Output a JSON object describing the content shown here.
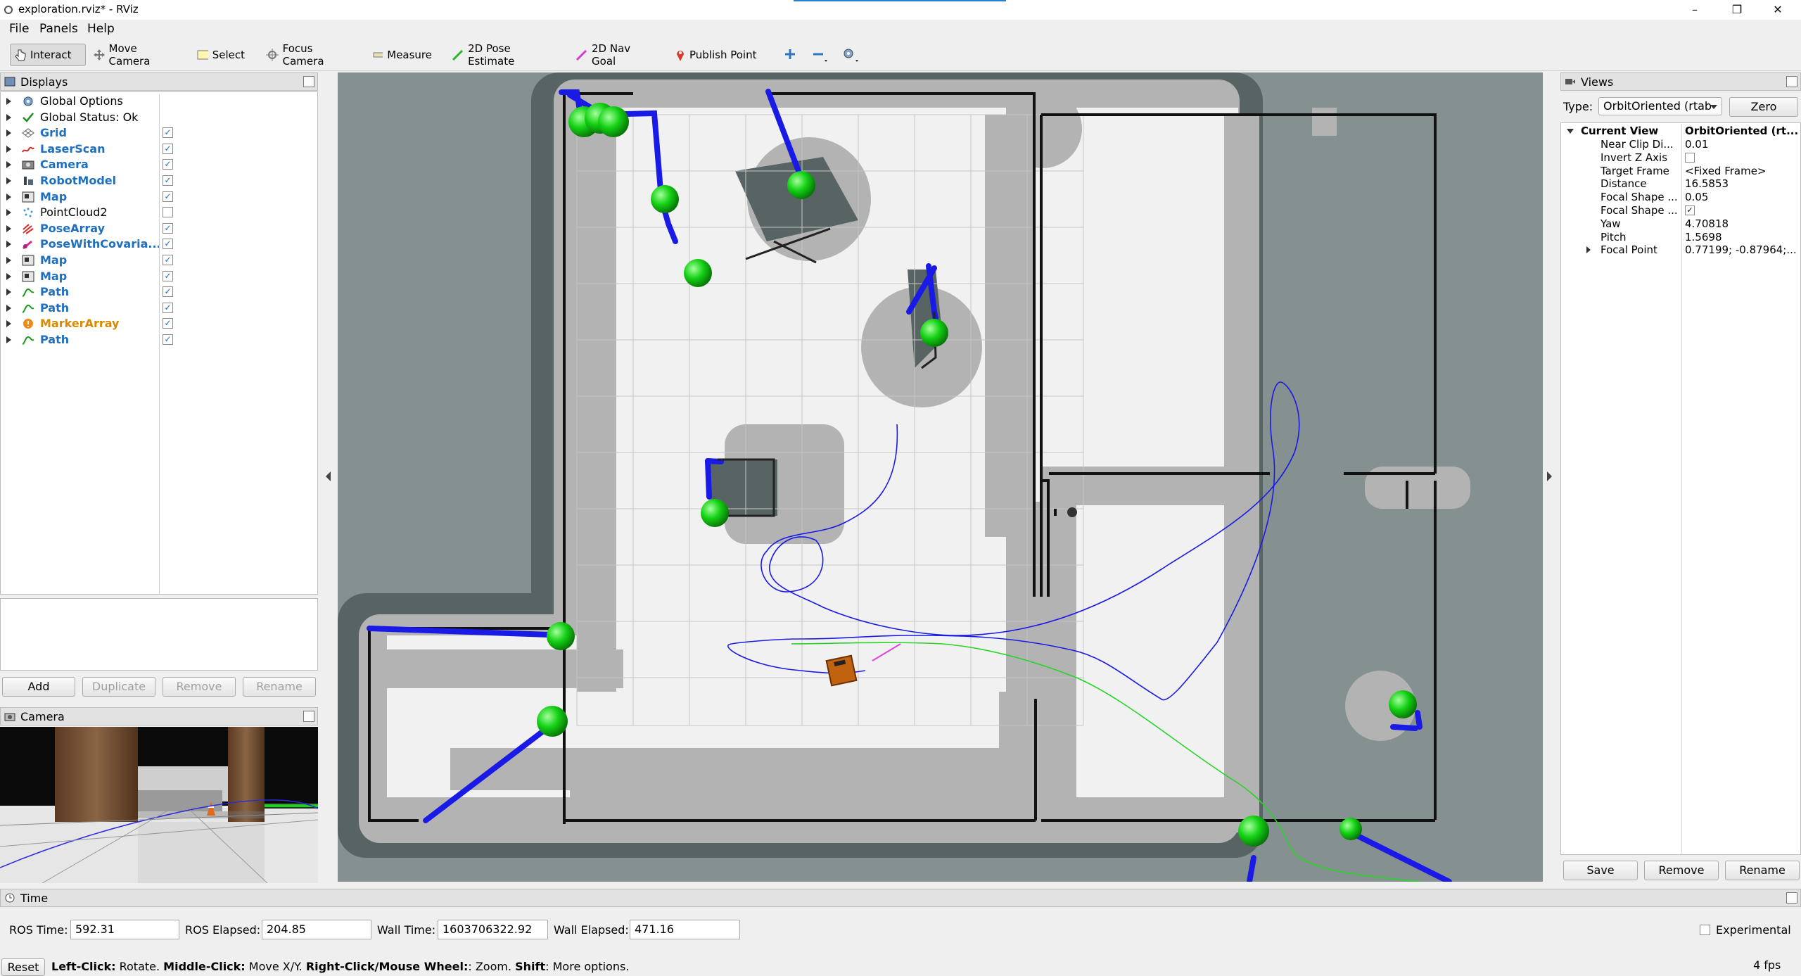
{
  "window": {
    "title": "exploration.rviz* - RViz",
    "minimize": "–",
    "maximize": "❐",
    "close": "✕"
  },
  "menubar": [
    "File",
    "Panels",
    "Help"
  ],
  "toolbar": {
    "interact": "Interact",
    "move_camera": "Move Camera",
    "select": "Select",
    "focus_camera": "Focus Camera",
    "measure": "Measure",
    "pose_estimate": "2D Pose Estimate",
    "nav_goal": "2D Nav Goal",
    "publish_point": "Publish Point"
  },
  "displays": {
    "title": "Displays",
    "items": [
      {
        "name": "Global Options",
        "style": "plain",
        "checkbox": null,
        "icon": "gear-icon"
      },
      {
        "name": "Global Status: Ok",
        "style": "plain",
        "checkbox": null,
        "icon": "checkmark-icon"
      },
      {
        "name": "Grid",
        "style": "blue",
        "checkbox": true,
        "icon": "grid-icon"
      },
      {
        "name": "LaserScan",
        "style": "blue",
        "checkbox": true,
        "icon": "laser-icon"
      },
      {
        "name": "Camera",
        "style": "blue",
        "checkbox": true,
        "icon": "camera-icon"
      },
      {
        "name": "RobotModel",
        "style": "blue",
        "checkbox": true,
        "icon": "robot-icon"
      },
      {
        "name": "Map",
        "style": "blue",
        "checkbox": true,
        "icon": "map-icon"
      },
      {
        "name": "PointCloud2",
        "style": "plain",
        "checkbox": false,
        "icon": "pointcloud-icon"
      },
      {
        "name": "PoseArray",
        "style": "blue",
        "checkbox": true,
        "icon": "posearray-icon"
      },
      {
        "name": "PoseWithCovaria...",
        "style": "blue",
        "checkbox": true,
        "icon": "pose-covariance-icon"
      },
      {
        "name": "Map",
        "style": "blue",
        "checkbox": true,
        "icon": "map-icon"
      },
      {
        "name": "Map",
        "style": "blue",
        "checkbox": true,
        "icon": "map-icon"
      },
      {
        "name": "Path",
        "style": "blue",
        "checkbox": true,
        "icon": "path-icon"
      },
      {
        "name": "Path",
        "style": "blue",
        "checkbox": true,
        "icon": "path-icon"
      },
      {
        "name": "MarkerArray",
        "style": "orange",
        "checkbox": true,
        "icon": "warning-icon"
      },
      {
        "name": "Path",
        "style": "blue",
        "checkbox": true,
        "icon": "path-icon"
      }
    ],
    "buttons": {
      "add": "Add",
      "duplicate": "Duplicate",
      "remove": "Remove",
      "rename": "Rename"
    }
  },
  "camera_panel": {
    "title": "Camera"
  },
  "views": {
    "title": "Views",
    "type_label": "Type:",
    "type_value": "OrbitOriented (rtab",
    "zero": "Zero",
    "current_view_label": "Current View",
    "current_view_value": "OrbitOriented (rt...",
    "props": [
      {
        "name": "Near Clip Di...",
        "value": "0.01",
        "check": null
      },
      {
        "name": "Invert Z Axis",
        "value": "",
        "check": false
      },
      {
        "name": "Target Frame",
        "value": "<Fixed Frame>",
        "check": null
      },
      {
        "name": "Distance",
        "value": "16.5853",
        "check": null
      },
      {
        "name": "Focal Shape ...",
        "value": "0.05",
        "check": null
      },
      {
        "name": "Focal Shape ...",
        "value": "",
        "check": true
      },
      {
        "name": "Yaw",
        "value": "4.70818",
        "check": null
      },
      {
        "name": "Pitch",
        "value": "1.5698",
        "check": null
      },
      {
        "name": "Focal Point",
        "value": "0.77199; -0.87964;...",
        "check": null
      }
    ],
    "buttons": {
      "save": "Save",
      "remove": "Remove",
      "rename": "Rename"
    }
  },
  "time": {
    "title": "Time",
    "ros_time_label": "ROS Time:",
    "ros_time": "592.31",
    "ros_elapsed_label": "ROS Elapsed:",
    "ros_elapsed": "204.85",
    "wall_time_label": "Wall Time:",
    "wall_time": "1603706322.92",
    "wall_elapsed_label": "Wall Elapsed:",
    "wall_elapsed": "471.16",
    "experimental": "Experimental"
  },
  "status": {
    "reset": "Reset",
    "left_click_key": "Left-Click:",
    "left_click_val": " Rotate. ",
    "middle_click_key": "Middle-Click:",
    "middle_click_val": " Move X/Y. ",
    "right_click_key": "Right-Click/Mouse Wheel:",
    "right_click_val": ": Zoom. ",
    "shift_key": "Shift",
    "shift_val": ": More options.",
    "fps": "4 fps"
  },
  "colors": {
    "path_blue": "#1a1ae6",
    "path_green": "#27d427",
    "frontier_green": "#11c511",
    "robot_orange": "#c0620e",
    "costmap_dark": "#586463",
    "costmap_light": "#b3b3b3",
    "free_space": "#f1f1f1"
  }
}
